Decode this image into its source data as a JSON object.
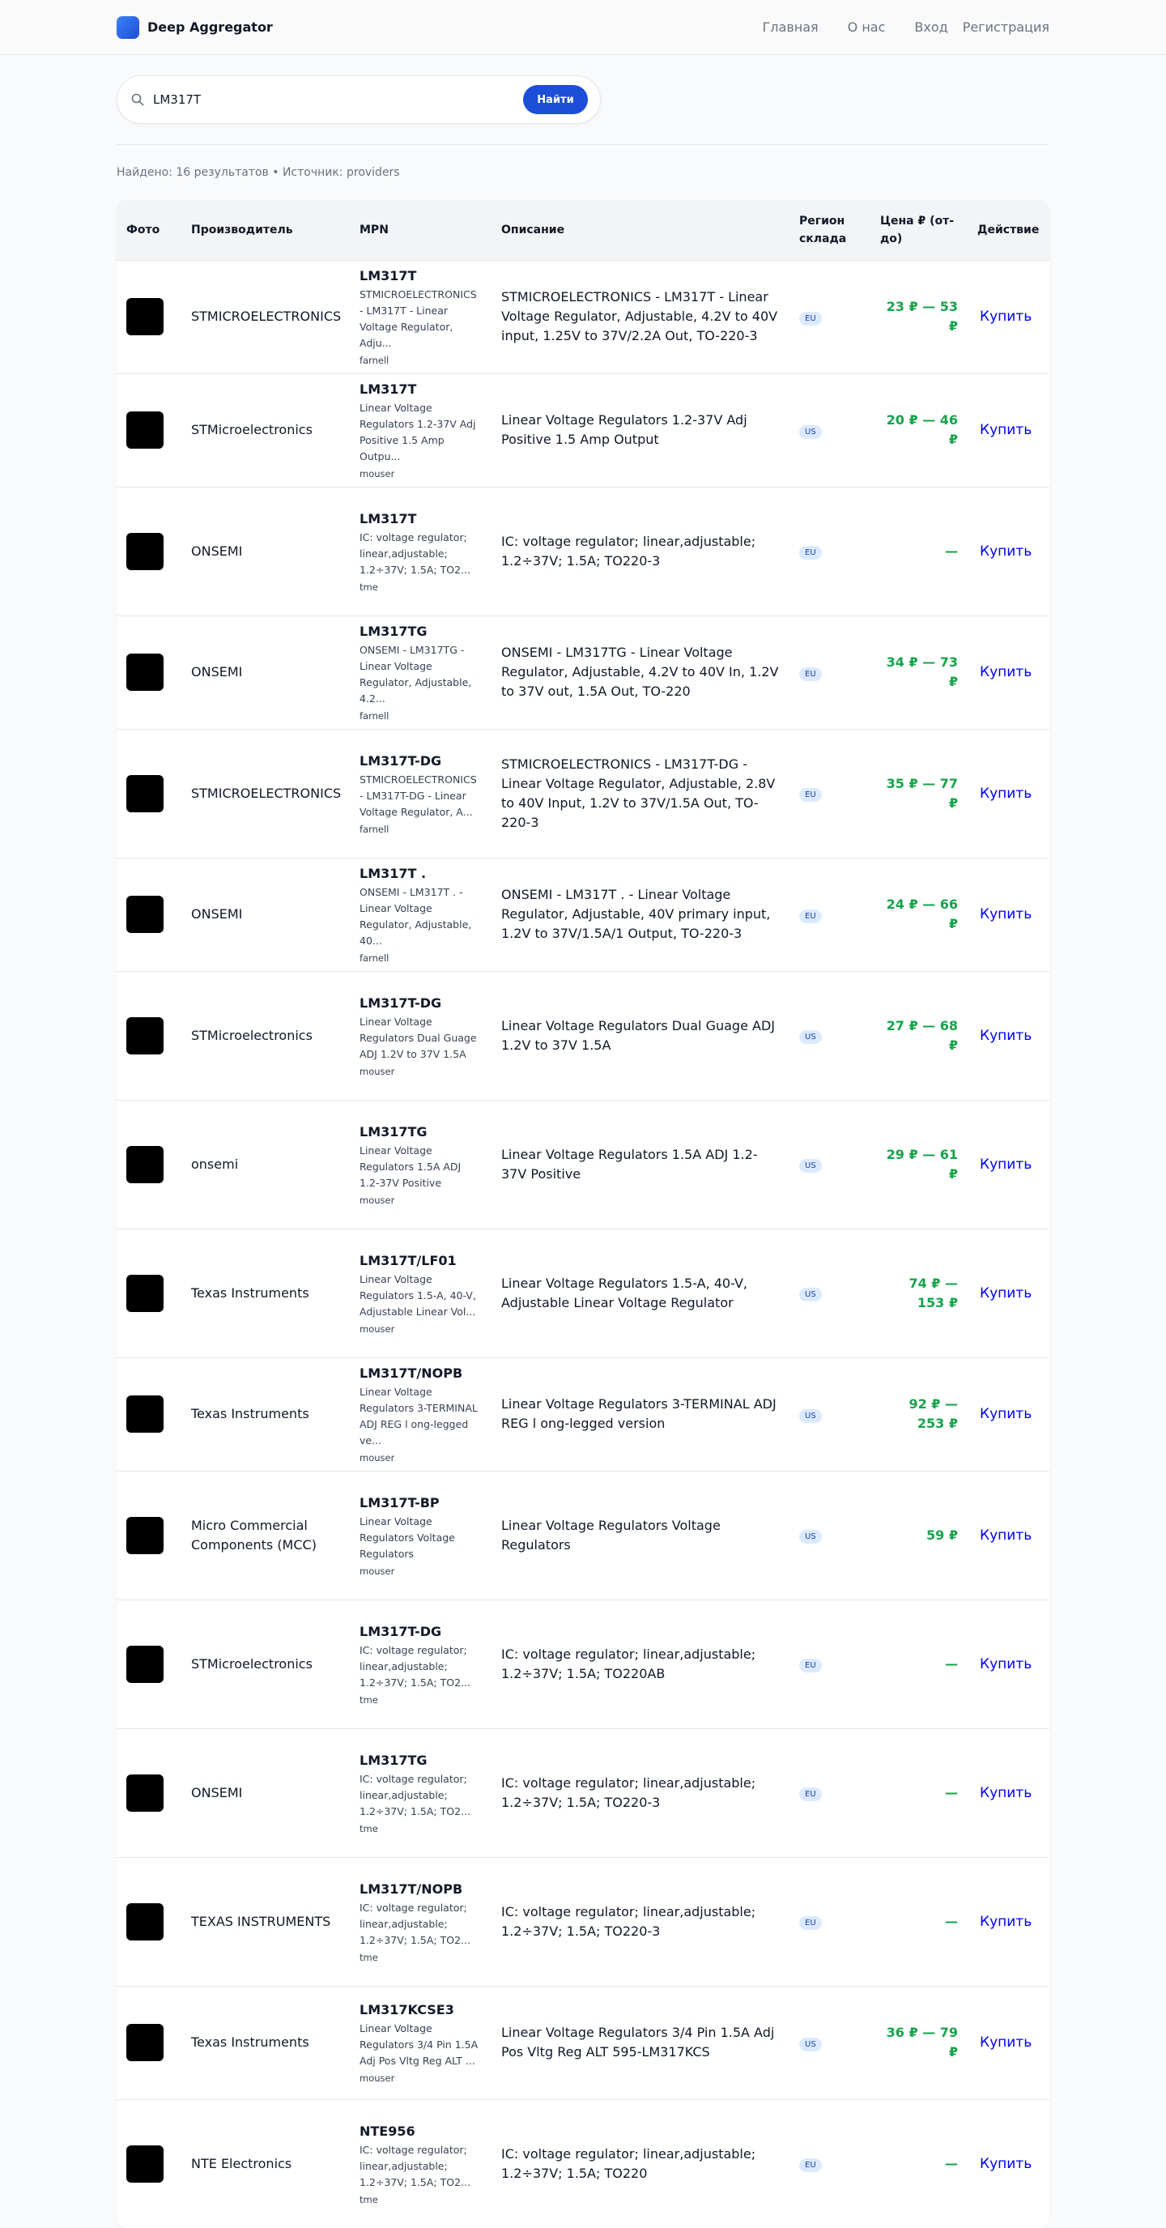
{
  "header": {
    "brand": "Deep Aggregator",
    "nav": [
      "Главная",
      "О нас",
      "Вход",
      "Регистрация"
    ]
  },
  "search": {
    "query": "LM317T",
    "button_label": "Найти"
  },
  "summary": "Найдено: 16 результатов • Источник: providers",
  "table": {
    "headers": [
      "Фото",
      "Производитель",
      "MPN",
      "Описание",
      "Регион склада",
      "Цена ₽ (от-до)",
      "Действие"
    ],
    "rows": [
      {
        "manufacturer": "STMICROELECTRONICS",
        "mpn": "LM317T",
        "mpn_desc": "STMICROELECTRONICS - LM317T - Linear Voltage Regulator, Adju...",
        "provider": "farnell",
        "description": "STMICROELECTRONICS - LM317T - Linear Voltage Regulator, Adjustable, 4.2V to 40V input, 1.25V to 37V/2.2A Out, TO-220-3",
        "region": "EU",
        "price": "23 ₽ — 53 ₽",
        "action": "Купить"
      },
      {
        "manufacturer": "STMicroelectronics",
        "mpn": "LM317T",
        "mpn_desc": "Linear Voltage Regulators 1.2-37V Adj Positive 1.5 Amp Outpu...",
        "provider": "mouser",
        "description": "Linear Voltage Regulators 1.2-37V Adj Positive 1.5 Amp Output",
        "region": "US",
        "price": "20 ₽ — 46 ₽",
        "action": "Купить"
      },
      {
        "manufacturer": "ONSEMI",
        "mpn": "LM317T",
        "mpn_desc": "IC: voltage regulator; linear,adjustable; 1.2÷37V; 1.5A; TO2...",
        "provider": "tme",
        "description": "IC: voltage regulator; linear,adjustable; 1.2÷37V; 1.5A; TO220-3",
        "region": "EU",
        "price": "—",
        "action": "Купить"
      },
      {
        "manufacturer": "ONSEMI",
        "mpn": "LM317TG",
        "mpn_desc": "ONSEMI - LM317TG - Linear Voltage Regulator, Adjustable, 4.2...",
        "provider": "farnell",
        "description": "ONSEMI - LM317TG - Linear Voltage Regulator, Adjustable, 4.2V to 40V In, 1.2V to 37V out, 1.5A Out, TO-220",
        "region": "EU",
        "price": "34 ₽ — 73 ₽",
        "action": "Купить"
      },
      {
        "manufacturer": "STMICROELECTRONICS",
        "mpn": "LM317T-DG",
        "mpn_desc": "STMICROELECTRONICS - LM317T-DG - Linear Voltage Regulator, A...",
        "provider": "farnell",
        "description": "STMICROELECTRONICS - LM317T-DG - Linear Voltage Regulator, Adjustable, 2.8V to 40V Input, 1.2V to 37V/1.5A Out, TO-220-3",
        "region": "EU",
        "price": "35 ₽ — 77 ₽",
        "action": "Купить"
      },
      {
        "manufacturer": "ONSEMI",
        "mpn": "LM317T .",
        "mpn_desc": "ONSEMI - LM317T . - Linear Voltage Regulator, Adjustable, 40...",
        "provider": "farnell",
        "description": "ONSEMI - LM317T . - Linear Voltage Regulator, Adjustable, 40V primary input, 1.2V to 37V/1.5A/1 Output, TO-220-3",
        "region": "EU",
        "price": "24 ₽ — 66 ₽",
        "action": "Купить"
      },
      {
        "manufacturer": "STMicroelectronics",
        "mpn": "LM317T-DG",
        "mpn_desc": "Linear Voltage Regulators Dual Guage ADJ 1.2V to 37V 1.5A",
        "provider": "mouser",
        "description": "Linear Voltage Regulators Dual Guage ADJ 1.2V to 37V 1.5A",
        "region": "US",
        "price": "27 ₽ — 68 ₽",
        "action": "Купить"
      },
      {
        "manufacturer": "onsemi",
        "mpn": "LM317TG",
        "mpn_desc": "Linear Voltage Regulators 1.5A ADJ 1.2-37V Positive",
        "provider": "mouser",
        "description": "Linear Voltage Regulators 1.5A ADJ 1.2-37V Positive",
        "region": "US",
        "price": "29 ₽ — 61 ₽",
        "action": "Купить"
      },
      {
        "manufacturer": "Texas Instruments",
        "mpn": "LM317T/LF01",
        "mpn_desc": "Linear Voltage Regulators 1.5-A, 40-V, Adjustable Linear Vol...",
        "provider": "mouser",
        "description": "Linear Voltage Regulators 1.5-A, 40-V, Adjustable Linear Voltage Regulator",
        "region": "US",
        "price": "74 ₽ — 153 ₽",
        "action": "Купить"
      },
      {
        "manufacturer": "Texas Instruments",
        "mpn": "LM317T/NOPB",
        "mpn_desc": "Linear Voltage Regulators 3-TERMINAL ADJ REG l ong-legged ve...",
        "provider": "mouser",
        "description": "Linear Voltage Regulators 3-TERMINAL ADJ REG l ong-legged version",
        "region": "US",
        "price": "92 ₽ — 253 ₽",
        "action": "Купить"
      },
      {
        "manufacturer": "Micro Commercial Components (MCC)",
        "mpn": "LM317T-BP",
        "mpn_desc": "Linear Voltage Regulators Voltage Regulators",
        "provider": "mouser",
        "description": "Linear Voltage Regulators Voltage Regulators",
        "region": "US",
        "price": "59 ₽",
        "action": "Купить"
      },
      {
        "manufacturer": "STMicroelectronics",
        "mpn": "LM317T-DG",
        "mpn_desc": "IC: voltage regulator; linear,adjustable; 1.2÷37V; 1.5A; TO2...",
        "provider": "tme",
        "description": "IC: voltage regulator; linear,adjustable; 1.2÷37V; 1.5A; TO220AB",
        "region": "EU",
        "price": "—",
        "action": "Купить"
      },
      {
        "manufacturer": "ONSEMI",
        "mpn": "LM317TG",
        "mpn_desc": "IC: voltage regulator; linear,adjustable; 1.2÷37V; 1.5A; TO2...",
        "provider": "tme",
        "description": "IC: voltage regulator; linear,adjustable; 1.2÷37V; 1.5A; TO220-3",
        "region": "EU",
        "price": "—",
        "action": "Купить"
      },
      {
        "manufacturer": "TEXAS INSTRUMENTS",
        "mpn": "LM317T/NOPB",
        "mpn_desc": "IC: voltage regulator; linear,adjustable; 1.2÷37V; 1.5A; TO2...",
        "provider": "tme",
        "description": "IC: voltage regulator; linear,adjustable; 1.2÷37V; 1.5A; TO220-3",
        "region": "EU",
        "price": "—",
        "action": "Купить"
      },
      {
        "manufacturer": "Texas Instruments",
        "mpn": "LM317KCSE3",
        "mpn_desc": "Linear Voltage Regulators 3/4 Pin 1.5A Adj Pos Vltg Reg ALT ...",
        "provider": "mouser",
        "description": "Linear Voltage Regulators 3/4 Pin 1.5A Adj Pos Vltg Reg ALT 595-LM317KCS",
        "region": "US",
        "price": "36 ₽ — 79 ₽",
        "action": "Купить"
      },
      {
        "manufacturer": "NTE Electronics",
        "mpn": "NTE956",
        "mpn_desc": "IC: voltage regulator; linear,adjustable; 1.2÷37V; 1.5A; TO2...",
        "provider": "tme",
        "description": "IC: voltage regulator; linear,adjustable; 1.2÷37V; 1.5A; TO220",
        "region": "EU",
        "price": "—",
        "action": "Купить"
      }
    ]
  }
}
